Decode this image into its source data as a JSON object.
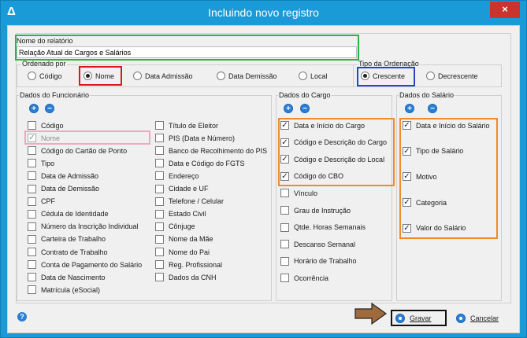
{
  "window": {
    "title": "Incluindo novo registro",
    "app_icon": "delta-icon",
    "close_glyph": "×"
  },
  "report": {
    "name_label": "Nome do relatório",
    "name_value": "Relação Atual de Cargos e Salários"
  },
  "order_by": {
    "legend": "Ordenado por",
    "options": [
      "Código",
      "Nome",
      "Data Admissão",
      "Data Demissão",
      "Local"
    ],
    "selected": "Nome"
  },
  "order_type": {
    "legend": "Tipo da Ordenação",
    "options": [
      "Crescente",
      "Decrescente"
    ],
    "selected": "Crescente"
  },
  "employee": {
    "legend": "Dados do Funcionário",
    "col1": [
      {
        "label": "Código",
        "checked": false
      },
      {
        "label": "Nome",
        "checked": true,
        "disabled": true
      },
      {
        "label": "Código do Cartão de Ponto",
        "checked": false
      },
      {
        "label": "Tipo",
        "checked": false
      },
      {
        "label": "Data de Admissão",
        "checked": false
      },
      {
        "label": "Data de Demissão",
        "checked": false
      },
      {
        "label": "CPF",
        "checked": false
      },
      {
        "label": "Cédula de Identidade",
        "checked": false
      },
      {
        "label": "Número da Inscrição Individual",
        "checked": false
      },
      {
        "label": "Carteira de Trabalho",
        "checked": false
      },
      {
        "label": "Contrato de Trabalho",
        "checked": false
      },
      {
        "label": "Conta de Pagamento do Salário",
        "checked": false
      },
      {
        "label": "Data de Nascimento",
        "checked": false
      },
      {
        "label": "Matrícula (eSocial)",
        "checked": false
      }
    ],
    "col2": [
      {
        "label": "Título de Eleitor",
        "checked": false
      },
      {
        "label": "PIS (Data e Número)",
        "checked": false
      },
      {
        "label": "Banco de Recolhimento do PIS",
        "checked": false
      },
      {
        "label": "Data e Código do FGTS",
        "checked": false
      },
      {
        "label": "Endereço",
        "checked": false
      },
      {
        "label": "Cidade e UF",
        "checked": false
      },
      {
        "label": "Telefone / Celular",
        "checked": false
      },
      {
        "label": "Estado Civil",
        "checked": false
      },
      {
        "label": "Cônjuge",
        "checked": false
      },
      {
        "label": "Nome da Mãe",
        "checked": false
      },
      {
        "label": "Nome do Pai",
        "checked": false
      },
      {
        "label": "Reg. Profissional",
        "checked": false
      },
      {
        "label": "Dados da CNH",
        "checked": false
      }
    ]
  },
  "position": {
    "legend": "Dados do Cargo",
    "items": [
      {
        "label": "Data e Início do Cargo",
        "checked": true
      },
      {
        "label": "Código e Descrição do Cargo",
        "checked": true
      },
      {
        "label": "Código e Descrição do Local",
        "checked": true
      },
      {
        "label": "Código do CBO",
        "checked": true
      },
      {
        "label": "Vínculo",
        "checked": false
      },
      {
        "label": "Grau de Instrução",
        "checked": false
      },
      {
        "label": "Qtde. Horas Semanais",
        "checked": false
      },
      {
        "label": "Descanso Semanal",
        "checked": false
      },
      {
        "label": "Horário de Trabalho",
        "checked": false
      },
      {
        "label": "Ocorrência",
        "checked": false
      }
    ]
  },
  "salary": {
    "legend": "Dados do Salário",
    "items": [
      {
        "label": "Data e Início do Salário",
        "checked": true
      },
      {
        "label": "Tipo de Salário",
        "checked": true
      },
      {
        "label": "Motivo",
        "checked": true
      },
      {
        "label": "Categoria",
        "checked": true
      },
      {
        "label": "Valor do Salário",
        "checked": true
      }
    ]
  },
  "actions": {
    "save_label": "Gravar",
    "cancel_label": "Cancelar",
    "help_glyph": "?"
  },
  "glyphs": {
    "check": "✓",
    "plus": "+",
    "minus": "−"
  },
  "colors": {
    "titlebar": "#1a9ad6",
    "highlight_green": "#2bb24c",
    "highlight_red": "#e0161e",
    "highlight_blue": "#2845c8",
    "highlight_pink": "#f2a7bf",
    "highlight_orange": "#f08a2a",
    "arrow": "#a06b3c"
  }
}
